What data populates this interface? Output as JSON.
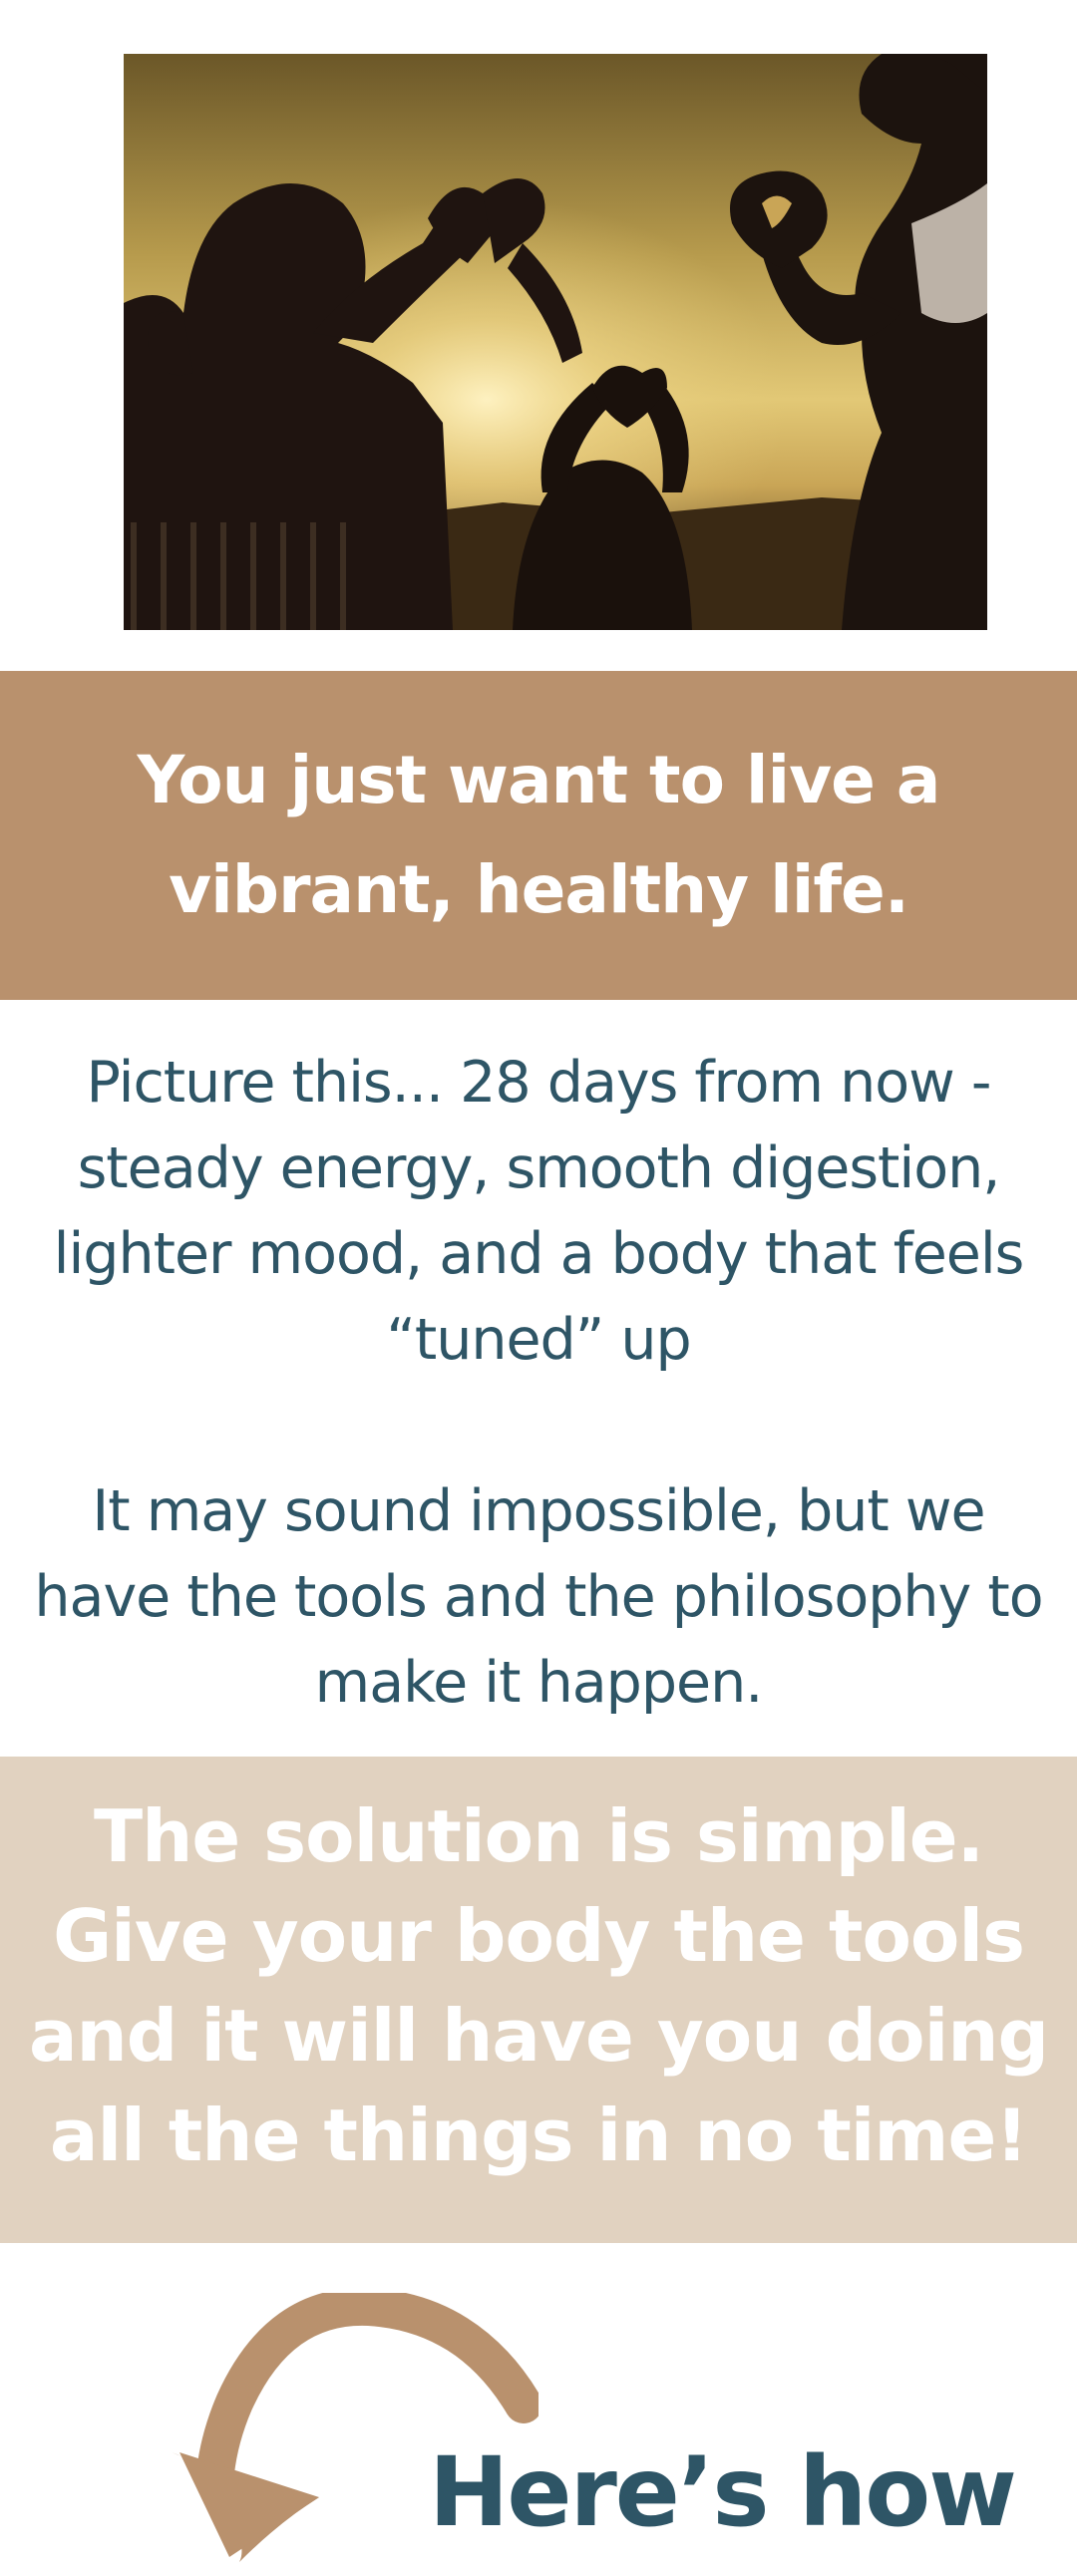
{
  "hero_image": {
    "description_icon": "family-silhouettes-making-heart-hands-at-sunset"
  },
  "headline": {
    "text": "You just want to live a vibrant, healthy life."
  },
  "body": {
    "paragraph_1": "Picture this... 28 days from now - steady energy, smooth digestion, lighter mood, and a body that feels “tuned” up",
    "paragraph_2": "It may sound impossible, but we have the tools and the philosophy to make it happen."
  },
  "solution": {
    "text": "The solution is simple. Give your body the tools and it will have you doing all the things in no time!"
  },
  "cta": {
    "label": "Here’s how",
    "arrow_icon": "curved-arrow-down-icon"
  },
  "colors": {
    "tan": "#b9916d",
    "beige": "#e1d2c0",
    "teal_text": "#2e5566",
    "white": "#ffffff"
  }
}
